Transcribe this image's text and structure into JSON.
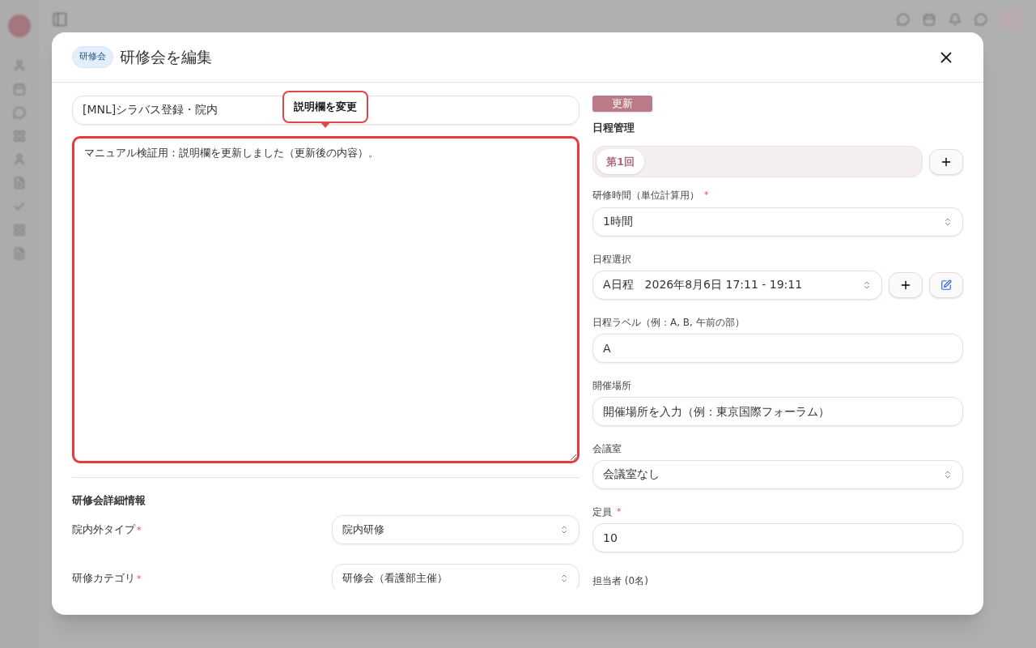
{
  "dialog": {
    "badge": "研修会",
    "title": "研修会を編集"
  },
  "title_field": {
    "value": "[MNL]シラバス登録・院内"
  },
  "annotation": {
    "text": "説明欄を変更"
  },
  "description": {
    "value": "マニュアル検証用：説明欄を更新しました（更新後の内容）。",
    "highlighted": true
  },
  "details": {
    "heading": "研修会詳細情報",
    "rows": [
      {
        "label": "院内外タイプ",
        "required_mark": "*",
        "value": "院内研修"
      },
      {
        "label": "研修カテゴリ",
        "required_mark": "*",
        "value": "研修会（看護部主催）"
      }
    ]
  },
  "update_button": "更新",
  "schedule": {
    "heading": "日程管理",
    "tabs": [
      {
        "label": "第1回",
        "selected": true
      }
    ]
  },
  "fields": [
    {
      "kind": "select",
      "label": "研修時間（単位計算用）",
      "required_mark": "*",
      "value": "1時間"
    },
    {
      "kind": "schedule-select",
      "label": "日程選択",
      "value": "A日程　2026年8月6日 17:11 - 19:11"
    },
    {
      "kind": "input",
      "label": "日程ラベル（例：A, B, 午前の部）",
      "value": "A"
    },
    {
      "kind": "input",
      "label": "開催場所",
      "placeholder": "開催場所を入力（例：東京国際フォーラム）"
    },
    {
      "kind": "select",
      "label": "会議室",
      "value": "会議室なし"
    },
    {
      "kind": "input",
      "label": "定員",
      "required_mark": "*",
      "value": "10"
    },
    {
      "kind": "label",
      "label": "担当者 (0名)"
    }
  ]
}
